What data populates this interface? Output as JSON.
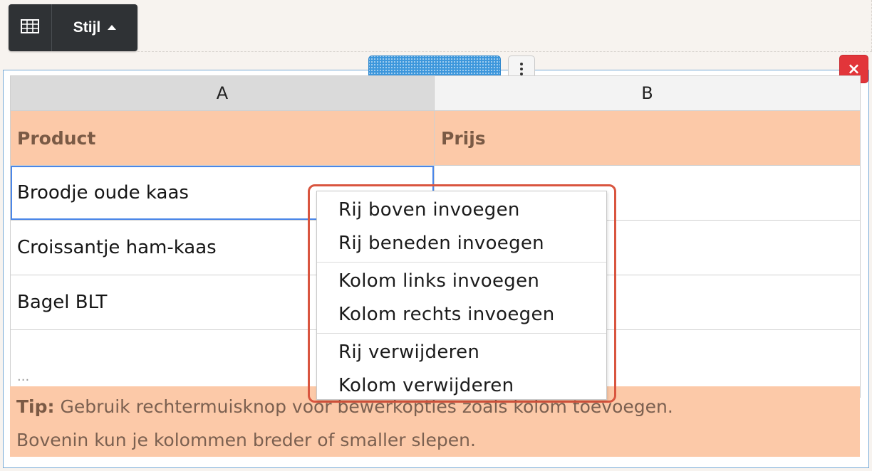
{
  "toolbar": {
    "table_icon": "table-grid-icon",
    "style_label": "Stijl",
    "style_caret": "caret-up-icon"
  },
  "controls": {
    "drag_handle_icon": "drag-grip-icon",
    "more_icon": "vertical-dots-icon",
    "close_label": "×"
  },
  "sheet": {
    "columns": [
      "A",
      "B"
    ],
    "header_row": [
      "Product",
      "Prijs"
    ],
    "rows": [
      [
        "Broodje oude kaas",
        ""
      ],
      [
        "Croissantje ham-kaas",
        ""
      ],
      [
        "Bagel BLT",
        ""
      ],
      [
        "...",
        ""
      ]
    ]
  },
  "tip": {
    "label": "Tip:",
    "line1": " Gebruik rechtermuisknop voor bewerkopties zoals kolom toevoegen.",
    "line2": "Bovenin kun je kolommen breder of smaller slepen."
  },
  "context_menu": {
    "groups": [
      [
        "Rij boven invoegen",
        "Rij beneden invoegen"
      ],
      [
        "Kolom links invoegen",
        "Kolom rechts invoegen"
      ],
      [
        "Rij verwijderen",
        "Kolom verwijderen"
      ]
    ]
  },
  "colors": {
    "header_fill": "#fcc9a8",
    "highlight_ring": "#d9553f",
    "selection": "#4a86e8",
    "close": "#e2353a",
    "handle": "#3d97dc"
  }
}
